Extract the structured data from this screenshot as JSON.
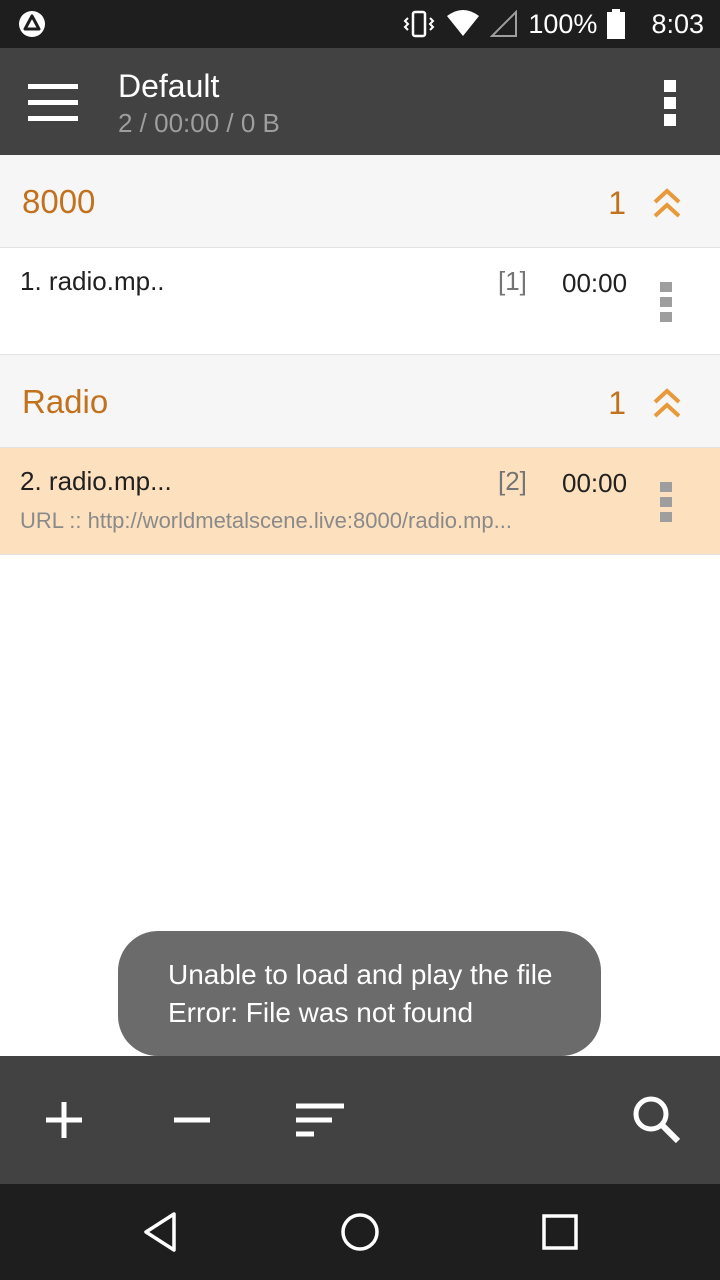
{
  "status_bar": {
    "battery": "100%",
    "time": "8:03"
  },
  "app_bar": {
    "title": "Default",
    "subtitle": "2 / 00:00 / 0 B"
  },
  "groups": [
    {
      "title": "8000",
      "count": "1",
      "tracks": [
        {
          "name": "1. radio.mp..",
          "index": "[1]",
          "time": "00:00",
          "url": "",
          "active": false
        }
      ]
    },
    {
      "title": "Radio",
      "count": "1",
      "tracks": [
        {
          "name": "2. radio.mp...",
          "index": "[2]",
          "time": "00:00",
          "url": "URL :: http://worldmetalscene.live:8000/radio.mp...",
          "active": true
        }
      ]
    }
  ],
  "toast": {
    "line1": "Unable to load and play the file",
    "line2": "Error: File was not found"
  },
  "icons": {
    "menu": "hamburger-icon",
    "overflow": "more-vert-icon",
    "collapse": "double-chevron-up-icon",
    "add": "plus-icon",
    "remove": "minus-icon",
    "sort": "sort-icon",
    "search": "search-icon",
    "back": "back-triangle-icon",
    "home": "home-circle-icon",
    "recents": "recents-square-icon"
  },
  "colors": {
    "accent": "#c2721e",
    "app_bar": "#424242",
    "active_row": "#fde0bd",
    "status_bar": "#1e1e1e"
  }
}
